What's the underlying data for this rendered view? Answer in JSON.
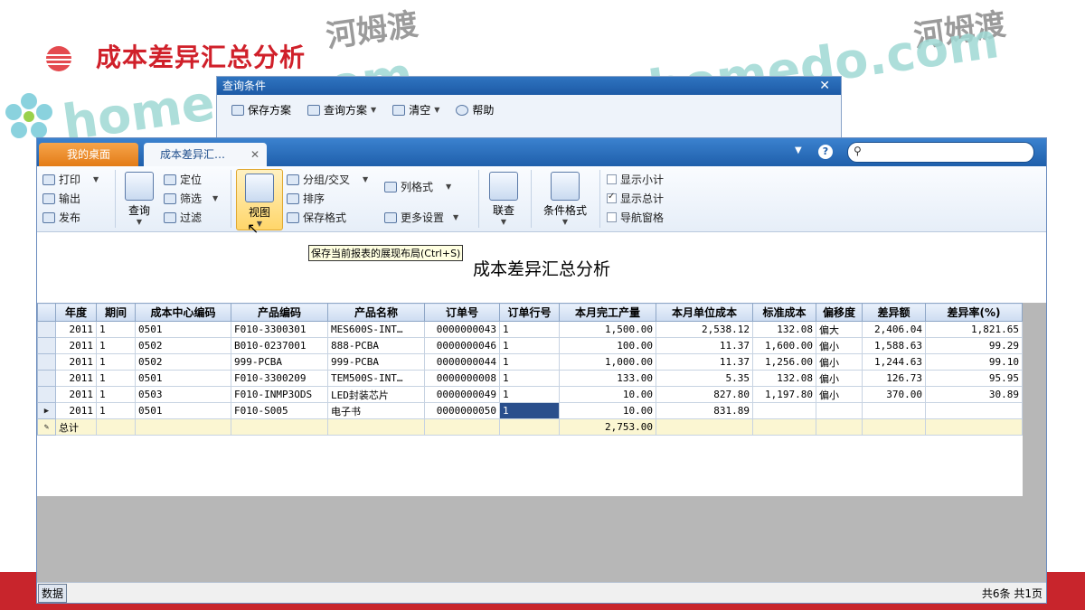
{
  "slide": {
    "title": "成本差异汇总分析"
  },
  "watermark": {
    "brand": "homedo.com",
    "cn": "河姆渡"
  },
  "query_dialog": {
    "title": "查询条件",
    "toolbar": [
      {
        "label": "保存方案",
        "icon": "save-icon"
      },
      {
        "label": "查询方案",
        "icon": "folder-icon",
        "dropdown": true
      },
      {
        "label": "清空",
        "icon": "clear-icon",
        "dropdown": true
      },
      {
        "label": "帮助",
        "icon": "help-icon"
      }
    ]
  },
  "tabs": {
    "home": "我的桌面",
    "active": "成本差异汇…"
  },
  "ribbon": {
    "print": "打印",
    "export": "输出",
    "publish": "发布",
    "query": "查询",
    "locate": "定位",
    "filter": "筛选",
    "filter2": "过滤",
    "view": "视图",
    "group": "分组/交叉",
    "sort": "排序",
    "save_format": "保存格式",
    "col_format": "列格式",
    "more_settings": "更多设置",
    "link_query": "联查",
    "cond_format": "条件格式",
    "show_subtotal": "显示小计",
    "show_total": "显示总计",
    "nav_pane": "导航窗格"
  },
  "tooltip": "保存当前报表的展现布局(Ctrl+S)",
  "report": {
    "title": "成本差异汇总分析",
    "columns": [
      "年度",
      "期间",
      "成本中心编码",
      "产品编码",
      "产品名称",
      "订单号",
      "订单行号",
      "本月完工产量",
      "本月单位成本",
      "标准成本",
      "偏移度",
      "差异额",
      "差异率(%)"
    ],
    "rows": [
      {
        "year": "2011",
        "period": "1",
        "cc": "0501",
        "code": "F010-3300301",
        "name": "MES600S-INT…",
        "order": "0000000043",
        "line": "1",
        "qty": "1,500.00",
        "unit_cost": "2,538.12",
        "std": "132.08",
        "dev": "偏大",
        "diff": "2,406.04",
        "rate": "1,821.65"
      },
      {
        "year": "2011",
        "period": "1",
        "cc": "0502",
        "code": "B010-0237001",
        "name": "888-PCBA",
        "order": "0000000046",
        "line": "1",
        "qty": "100.00",
        "unit_cost": "11.37",
        "std": "1,600.00",
        "dev": "偏小",
        "diff": "1,588.63",
        "rate": "99.29"
      },
      {
        "year": "2011",
        "period": "1",
        "cc": "0502",
        "code": "999-PCBA",
        "name": "999-PCBA",
        "order": "0000000044",
        "line": "1",
        "qty": "1,000.00",
        "unit_cost": "11.37",
        "std": "1,256.00",
        "dev": "偏小",
        "diff": "1,244.63",
        "rate": "99.10"
      },
      {
        "year": "2011",
        "period": "1",
        "cc": "0501",
        "code": "F010-3300209",
        "name": "TEM500S-INT…",
        "order": "0000000008",
        "line": "1",
        "qty": "133.00",
        "unit_cost": "5.35",
        "std": "132.08",
        "dev": "偏小",
        "diff": "126.73",
        "rate": "95.95"
      },
      {
        "year": "2011",
        "period": "1",
        "cc": "0503",
        "code": "F010-INMP3ODS",
        "name": "LED封装芯片",
        "order": "0000000049",
        "line": "1",
        "qty": "10.00",
        "unit_cost": "827.80",
        "std": "1,197.80",
        "dev": "偏小",
        "diff": "370.00",
        "rate": "30.89"
      },
      {
        "year": "2011",
        "period": "1",
        "cc": "0501",
        "code": "F010-S005",
        "name": "电子书",
        "order": "0000000050",
        "line": "1",
        "qty": "10.00",
        "unit_cost": "831.89",
        "std": "",
        "dev": "",
        "diff": "",
        "rate": ""
      }
    ],
    "total": {
      "label": "总计",
      "qty": "2,753.00"
    }
  },
  "status": {
    "tab": "数据",
    "info": "共6条  共1页"
  }
}
